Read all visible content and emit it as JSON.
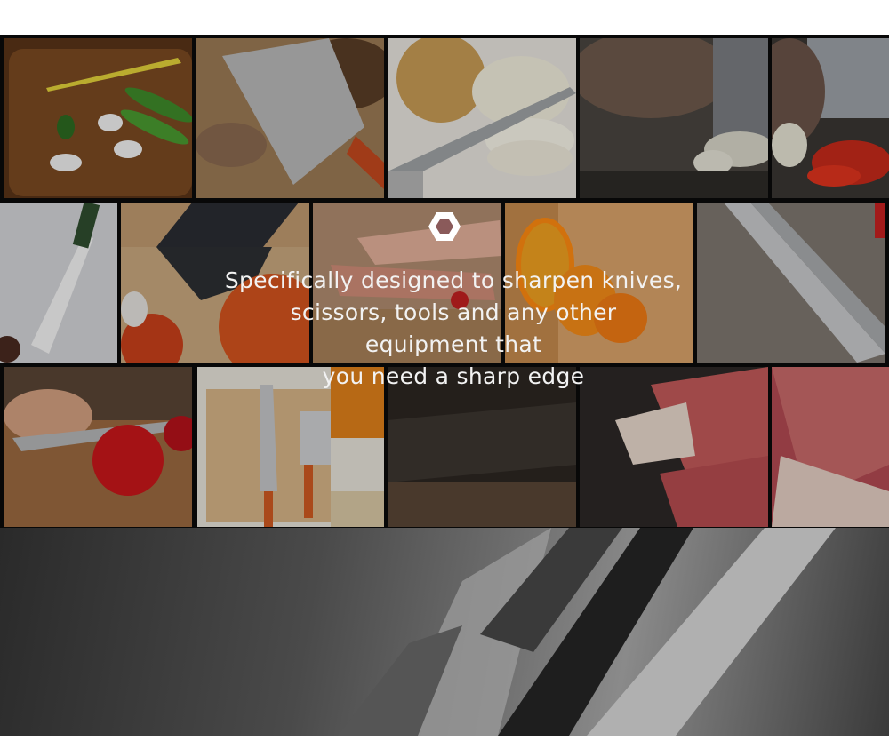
{
  "tagline": {
    "line1": "Specifically designed to sharpen knives,",
    "line2": "scissors, tools and any other",
    "line3": "equipment that",
    "line4": "you need a sharp edge"
  },
  "logo": {
    "icon": "hexagon-logo-icon",
    "color": "#ffffff"
  },
  "gallery": {
    "row1": [
      "scallions-cucumber-board",
      "cleaver-meat",
      "onion-slices-knife",
      "slicing-garlic",
      "red-chili-chopping"
    ],
    "row2": [
      "chef-knife-white",
      "knife-tomatoes",
      "bacon-board",
      "yellow-peppers",
      "serrated-knife-closeup"
    ],
    "row3": [
      "cutting-tomato",
      "knife-set-block",
      "dark-knife-board",
      "prosciutto-slices",
      "raw-meat-slices"
    ],
    "banner": "knife-handles-closeup"
  }
}
